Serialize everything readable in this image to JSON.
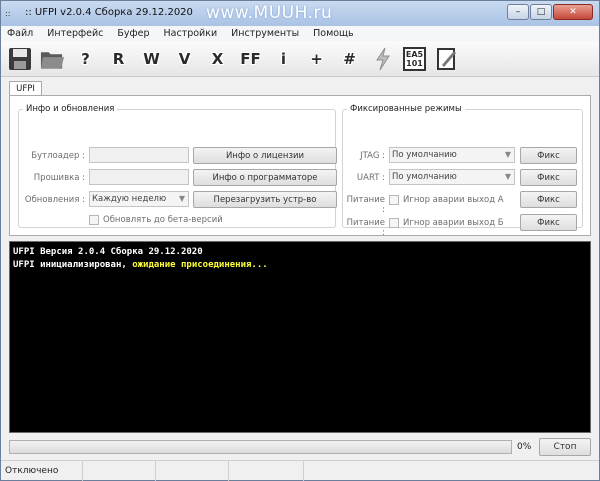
{
  "window": {
    "title": ":: UFPI v2.0.4 Сборка 29.12.2020",
    "watermark": "www.MUUH.ru",
    "minimize": "–",
    "maximize": "□",
    "close": "✕"
  },
  "menu": [
    "Файл",
    "Интерфейс",
    "Буфер",
    "Настройки",
    "Инструменты",
    "Помощь"
  ],
  "toolbar": {
    "icons": [
      "save-icon",
      "open-folder-icon",
      "question-icon",
      "r-icon",
      "w-icon",
      "v-icon",
      "x-icon",
      "ff-icon",
      "info-icon",
      "plus-icon",
      "hash-icon",
      "lightning-icon",
      "ea5-101-icon",
      "notepad-icon"
    ],
    "glyphs": {
      "question": "?",
      "r": "R",
      "w": "W",
      "v": "V",
      "x": "X",
      "ff": "FF",
      "info": "i",
      "plus": "+",
      "hash": "#",
      "ea_top": "EA5",
      "ea_bottom": "101"
    }
  },
  "tab": {
    "label": "UFPI"
  },
  "info_group": {
    "title": "Инфо и обновления",
    "bootloader_label": "Бутлоадер :",
    "firmware_label": "Прошивка :",
    "updates_label": "Обновления :",
    "updates_value": "Каждую неделю",
    "license_button": "Инфо о лицензии",
    "programmer_button": "Инфо о программаторе",
    "reboot_button": "Перезагрузить устр-во",
    "beta_checkbox": "Обновлять до бета-версий"
  },
  "fixed_group": {
    "title": "Фиксированные режимы",
    "jtag_label": "JTAG :",
    "jtag_value": "По умолчанию",
    "uart_label": "UART :",
    "uart_value": "По умолчанию",
    "power_label_a": "Питание :",
    "power_check_a": "Игнор аварии выход А",
    "power_label_b": "Питание :",
    "power_check_b": "Игнор аварии выход Б",
    "fix_button": "Фикс"
  },
  "console": {
    "line1": "UFPI Версия 2.0.4 Сборка 29.12.2020",
    "line2_prefix": "UFPI инициализирован, ",
    "line2_highlight": "ожидание присоединения...",
    "text_color": "#ffffff",
    "highlight_color": "#ffff38"
  },
  "progress": {
    "percent_label": "0%",
    "value": 0,
    "stop_label": "Стоп"
  },
  "status": {
    "text": "Отключено"
  }
}
